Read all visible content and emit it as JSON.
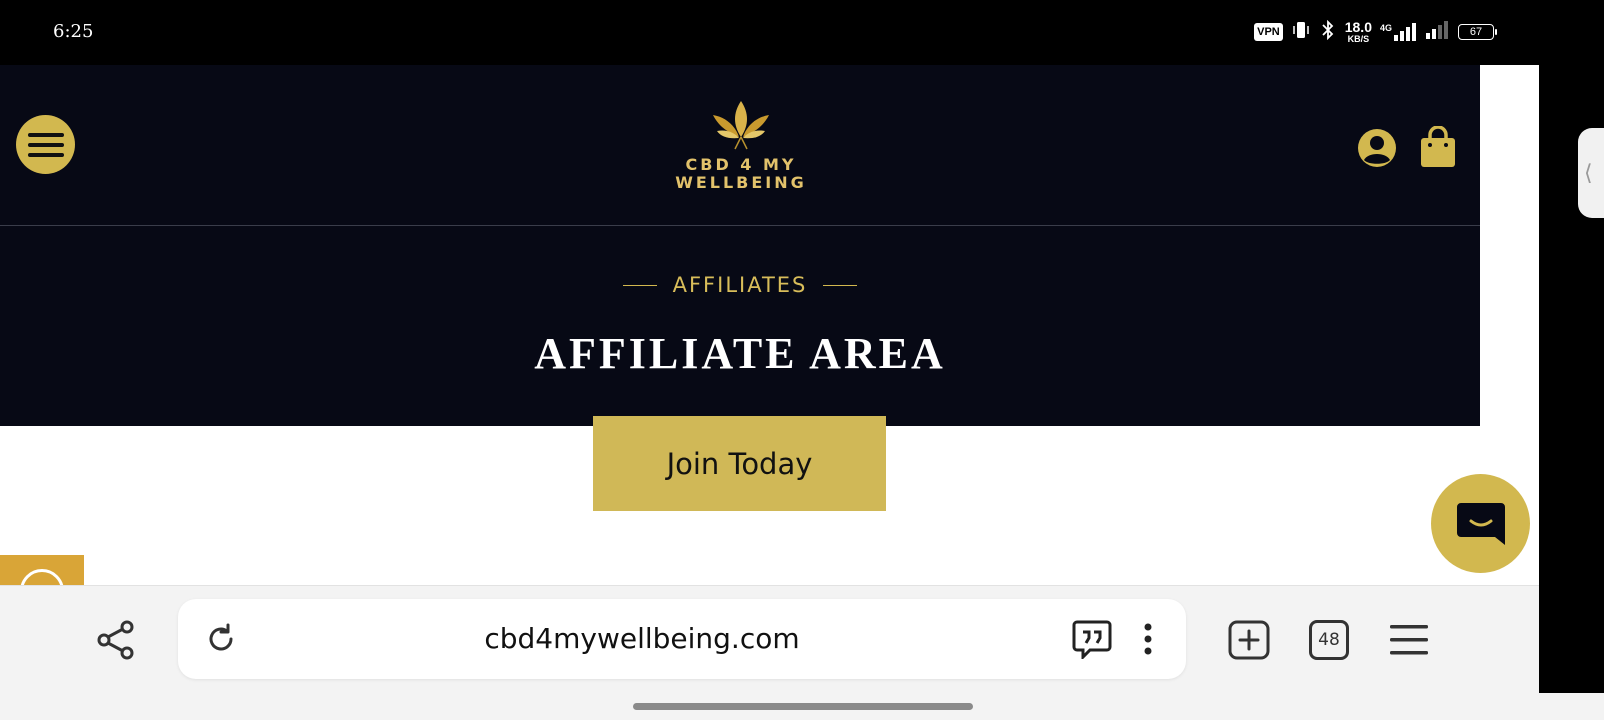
{
  "status_bar": {
    "time": "6:25",
    "vpn": "VPN",
    "net_speed_value": "18.0",
    "net_speed_unit": "KB/S",
    "network_type": "4G",
    "battery": "67",
    "icons": [
      "vibrate-icon",
      "bluetooth-icon",
      "signal-icon",
      "battery-icon"
    ]
  },
  "site": {
    "logo_line1": "CBD 4 MY",
    "logo_line2": "WELLBEING",
    "eyebrow": "AFFILIATES",
    "title": "AFFILIATE AREA",
    "cta_label": "Join Today",
    "colors": {
      "gold": "#d2b84f",
      "navy": "#070915",
      "button": "#d0b857",
      "accessibility": "#d9a537"
    },
    "icons": [
      "menu-icon",
      "leaf-logo-icon",
      "account-icon",
      "shopping-bag-icon",
      "chat-icon",
      "accessibility-icon"
    ]
  },
  "browser": {
    "url": "cbd4mywellbeing.com",
    "tab_count": "48",
    "side_handle": "⟨",
    "icons": [
      "share-icon",
      "reload-icon",
      "quote-icon",
      "more-vertical-icon",
      "new-tab-icon",
      "tabs-icon",
      "hamburger-menu-icon"
    ]
  }
}
